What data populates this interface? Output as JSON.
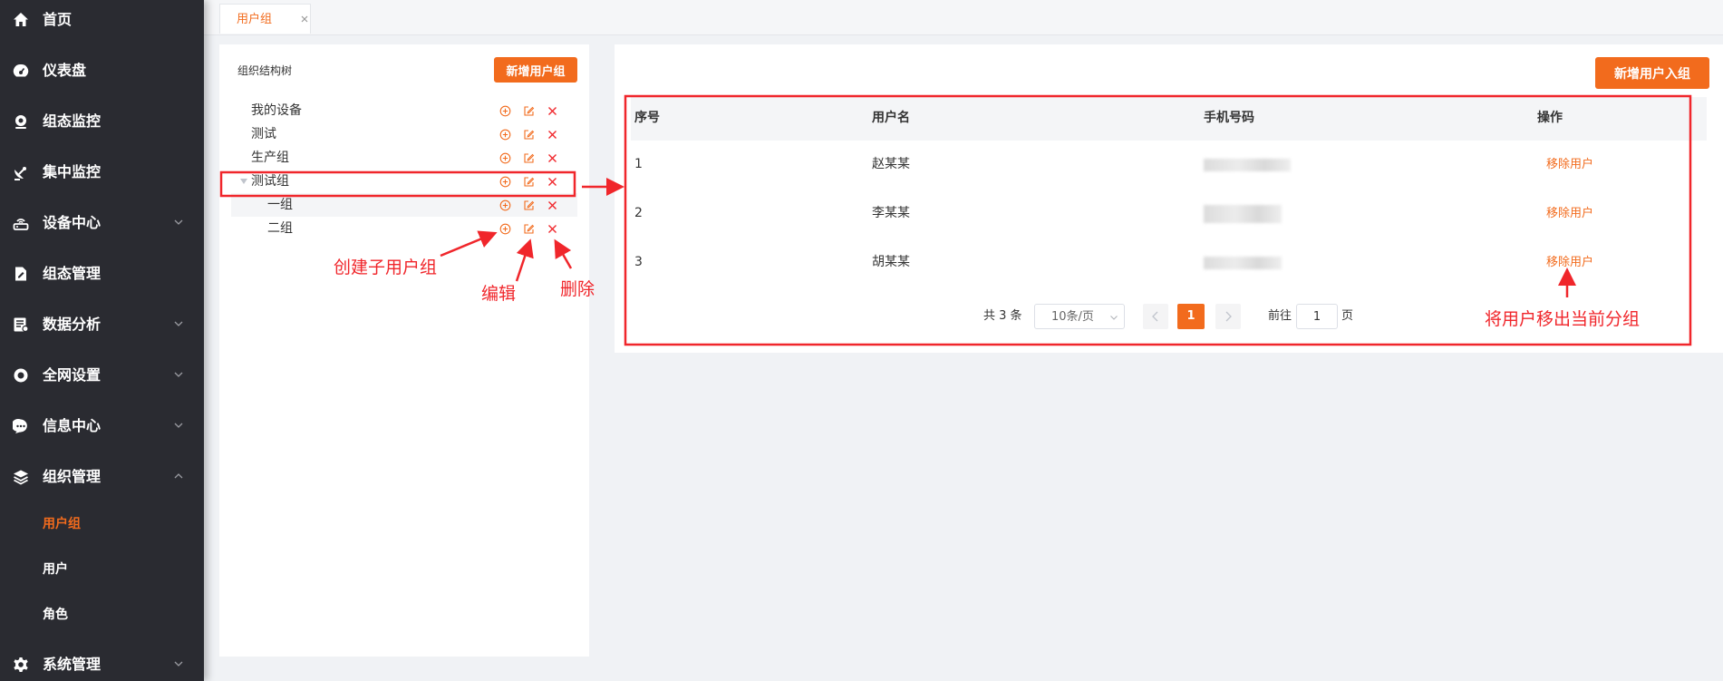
{
  "sidebar": {
    "items": [
      {
        "label": "首页",
        "icon": "home-icon"
      },
      {
        "label": "仪表盘",
        "icon": "dashboard-icon"
      },
      {
        "label": "组态监控",
        "icon": "webcam-icon"
      },
      {
        "label": "集中监控",
        "icon": "satellite-dish-icon"
      },
      {
        "label": "设备中心",
        "icon": "router-icon"
      },
      {
        "label": "组态管理",
        "icon": "document-edit-icon"
      },
      {
        "label": "数据分析",
        "icon": "report-icon"
      },
      {
        "label": "全网设置",
        "icon": "ring-icon"
      },
      {
        "label": "信息中心",
        "icon": "chat-icon"
      },
      {
        "label": "组织管理",
        "icon": "layers-icon"
      },
      {
        "label": "系统管理",
        "icon": "gear-icon"
      }
    ],
    "submenu": [
      {
        "label": "用户组",
        "active": true
      },
      {
        "label": "用户",
        "active": false
      },
      {
        "label": "角色",
        "active": false
      }
    ]
  },
  "tabs": [
    {
      "label": "用户组",
      "active": true
    }
  ],
  "tree": {
    "title": "组织结构树",
    "add_button": "新增用户组",
    "nodes": [
      {
        "label": "我的设备",
        "level": 0
      },
      {
        "label": "测试",
        "level": 0
      },
      {
        "label": "生产组",
        "level": 0
      },
      {
        "label": "测试组",
        "level": 0,
        "expanded": true
      },
      {
        "label": "一组",
        "level": 1
      },
      {
        "label": "二组",
        "level": 1
      }
    ]
  },
  "users": {
    "add_button": "新增用户入组",
    "columns": [
      "序号",
      "用户名",
      "手机号码",
      "操作"
    ],
    "rows": [
      {
        "index": "1",
        "username": "赵某某",
        "action": "移除用户"
      },
      {
        "index": "2",
        "username": "李某某",
        "action": "移除用户"
      },
      {
        "index": "3",
        "username": "胡某某",
        "action": "移除用户"
      }
    ],
    "pagination": {
      "total": "共 3 条",
      "page_size": "10条/页",
      "current": "1",
      "goto_label": "前往",
      "goto_value": "1",
      "page_suffix": "页"
    }
  },
  "annotations": {
    "create_sub": "创建子用户组",
    "edit": "编辑",
    "delete": "删除",
    "remove_user": "将用户移出当前分组"
  },
  "colors": {
    "accent": "#f26b1d",
    "sidebar_bg": "#2a2b31",
    "annotation": "#f0262b"
  }
}
